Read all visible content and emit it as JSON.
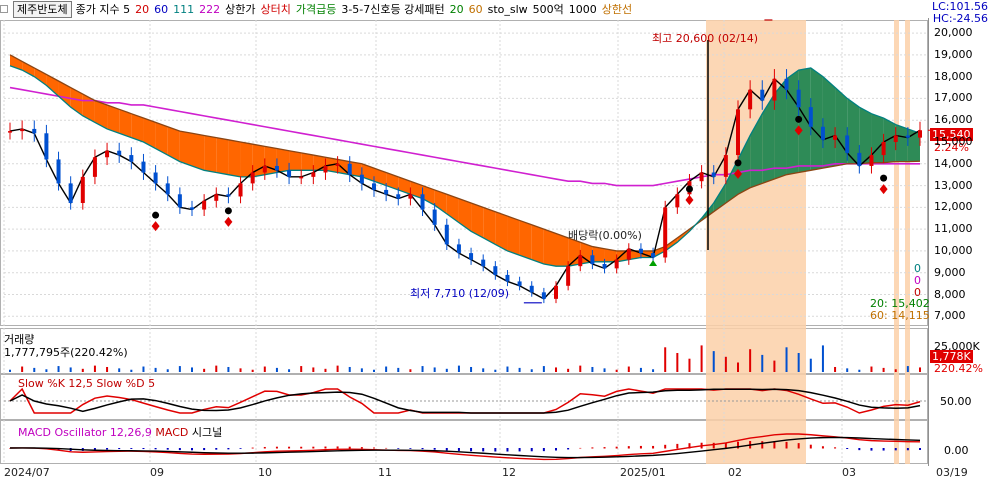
{
  "toolbar": {
    "stock_name": "제주반도체",
    "items": [
      {
        "text": "종가 지수 5",
        "color": "#000000"
      },
      {
        "text": "20",
        "color": "#d00000"
      },
      {
        "text": "60",
        "color": "#0000c0"
      },
      {
        "text": "111",
        "color": "#008080"
      },
      {
        "text": "222",
        "color": "#c000c0"
      },
      {
        "text": "상한가",
        "color": "#000000"
      },
      {
        "text": "상터치",
        "color": "#d00000"
      },
      {
        "text": "가격급등",
        "color": "#008000"
      },
      {
        "text": "3-5-7신호등 강세패턴",
        "color": "#000000"
      },
      {
        "text": "20",
        "color": "#008000"
      },
      {
        "text": "60",
        "color": "#c07000"
      },
      {
        "text": "sto_slw",
        "color": "#000000"
      },
      {
        "text": "500억",
        "color": "#000000"
      },
      {
        "text": "1000",
        "color": "#000000"
      },
      {
        "text": "상한선",
        "color": "#c07000"
      }
    ]
  },
  "corner": {
    "lc": "LC:101.56",
    "hc": "HC:-24.56"
  },
  "labels": {
    "high": "최고 20,600 (02/14)",
    "low": "최저 7,710 (12/09)",
    "dividend": "배당락(0.00%)",
    "current_price": "15,540",
    "change_pct": "2.24%",
    "ma20_value": "20: 15,402",
    "ma60_value": "60: 14,115",
    "zeros": [
      "0",
      "0",
      "0"
    ]
  },
  "panels": {
    "volume": {
      "title": "거래량",
      "value": "1,777,795주(220.42%)",
      "box_value": "1,778K",
      "box_pct": "220.42%",
      "axis_label": "25,000K"
    },
    "stochastic": {
      "title": "Slow %K 12,5  Slow %D 5",
      "axis_label": "50.00"
    },
    "macd": {
      "title_a": "MACD Oscillator 12,26,9",
      "title_b": "MACD",
      "title_c": "시그널",
      "axis_label": "0.00"
    }
  },
  "x_labels": [
    "2024/07",
    "09",
    "10",
    "11",
    "12",
    "2025/01",
    "02",
    "03",
    "03/19"
  ],
  "chart_data": {
    "type": "candlestick",
    "title": "",
    "price_axis": {
      "min": 7000,
      "max": 20000,
      "ticks": [
        7000,
        8000,
        9000,
        10000,
        11000,
        12000,
        13000,
        14000,
        15000,
        16000,
        17000,
        18000,
        19000,
        20000
      ]
    },
    "tick_labels": [
      "7,000",
      "8,000",
      "9,000",
      "10,000",
      "11,000",
      "12,000",
      "13,000",
      "14,000",
      "15,000",
      "16,000",
      "17,000",
      "18,000",
      "19,000",
      "20,000"
    ],
    "close_series": {
      "name": "종가",
      "values": [
        15500,
        15600,
        15400,
        14200,
        13100,
        12200,
        13400,
        14300,
        14600,
        14400,
        14100,
        13600,
        13100,
        12600,
        12000,
        11900,
        12300,
        12600,
        12500,
        13100,
        13600,
        13900,
        13700,
        13400,
        13400,
        13600,
        13900,
        14000,
        13500,
        13100,
        12800,
        12600,
        12400,
        12600,
        11900,
        11200,
        10300,
        9900,
        9600,
        9300,
        8900,
        8600,
        8400,
        8100,
        7800,
        8400,
        9300,
        9800,
        9400,
        9200,
        9600,
        10100,
        9900,
        9700,
        12000,
        12600,
        13200,
        13600,
        13400,
        14400,
        16500,
        17400,
        16900,
        17900,
        17400,
        16600,
        15700,
        15100,
        15300,
        14500,
        13900,
        14400,
        15000,
        15300,
        15200,
        15540
      ]
    },
    "ma20": {
      "name": "20",
      "values": [
        18500,
        18300,
        18000,
        17600,
        17100,
        16600,
        16200,
        15900,
        15600,
        15400,
        15200,
        15000,
        14700,
        14400,
        14100,
        13900,
        13700,
        13600,
        13500,
        13400,
        13400,
        13500,
        13600,
        13700,
        13700,
        13700,
        13700,
        13600,
        13500,
        13400,
        13200,
        13000,
        12800,
        12600,
        12400,
        12100,
        11700,
        11300,
        10900,
        10600,
        10300,
        10000,
        9800,
        9600,
        9400,
        9300,
        9300,
        9400,
        9500,
        9500,
        9500,
        9600,
        9700,
        9700,
        10000,
        10400,
        10900,
        11500,
        12200,
        13100,
        14200,
        15300,
        16300,
        17200,
        17900,
        18300,
        18400,
        18000,
        17500,
        17000,
        16600,
        16300,
        16100,
        15800,
        15600,
        15402
      ]
    },
    "ma60": {
      "name": "60",
      "values": [
        19000,
        18700,
        18400,
        18100,
        17800,
        17500,
        17200,
        16900,
        16700,
        16500,
        16300,
        16100,
        15900,
        15700,
        15500,
        15400,
        15300,
        15200,
        15100,
        15000,
        14900,
        14800,
        14700,
        14600,
        14500,
        14400,
        14300,
        14200,
        14100,
        14000,
        13800,
        13600,
        13400,
        13200,
        13000,
        12800,
        12600,
        12400,
        12200,
        12000,
        11800,
        11600,
        11400,
        11200,
        11000,
        10800,
        10600,
        10400,
        10200,
        10100,
        10000,
        10000,
        10000,
        10000,
        10200,
        10600,
        11000,
        11400,
        11800,
        12200,
        12600,
        12900,
        13100,
        13300,
        13500,
        13600,
        13700,
        13800,
        13900,
        14000,
        14000,
        14050,
        14050,
        14100,
        14100,
        14115
      ]
    },
    "ma222": {
      "name": "222",
      "values": [
        17500,
        17400,
        17300,
        17200,
        17100,
        17000,
        16900,
        16900,
        16800,
        16800,
        16700,
        16700,
        16600,
        16500,
        16400,
        16300,
        16200,
        16100,
        16000,
        15900,
        15800,
        15700,
        15600,
        15500,
        15400,
        15300,
        15200,
        15100,
        15000,
        14900,
        14800,
        14700,
        14600,
        14500,
        14400,
        14300,
        14200,
        14100,
        14000,
        13900,
        13800,
        13700,
        13600,
        13500,
        13400,
        13300,
        13200,
        13200,
        13100,
        13100,
        13000,
        13000,
        13000,
        13000,
        13100,
        13200,
        13300,
        13400,
        13500,
        13500,
        13600,
        13700,
        13700,
        13800,
        13800,
        13900,
        13900,
        13900,
        14000,
        14000,
        14000,
        14000,
        14000,
        14000,
        14000,
        14000
      ]
    },
    "markers": {
      "high": {
        "index": 63,
        "price": 20600
      },
      "low": {
        "index": 44,
        "price": 7710
      }
    }
  },
  "colors": {
    "up": "#e00000",
    "down": "#0050d0",
    "cloud_down": "#ff6600",
    "cloud_up": "#2e8b57",
    "highlight": "#fcd0a8",
    "ma222": "#d020d0",
    "ma60": "#8b4513",
    "ma20": "#008080",
    "grid": "#d9d9d9"
  }
}
